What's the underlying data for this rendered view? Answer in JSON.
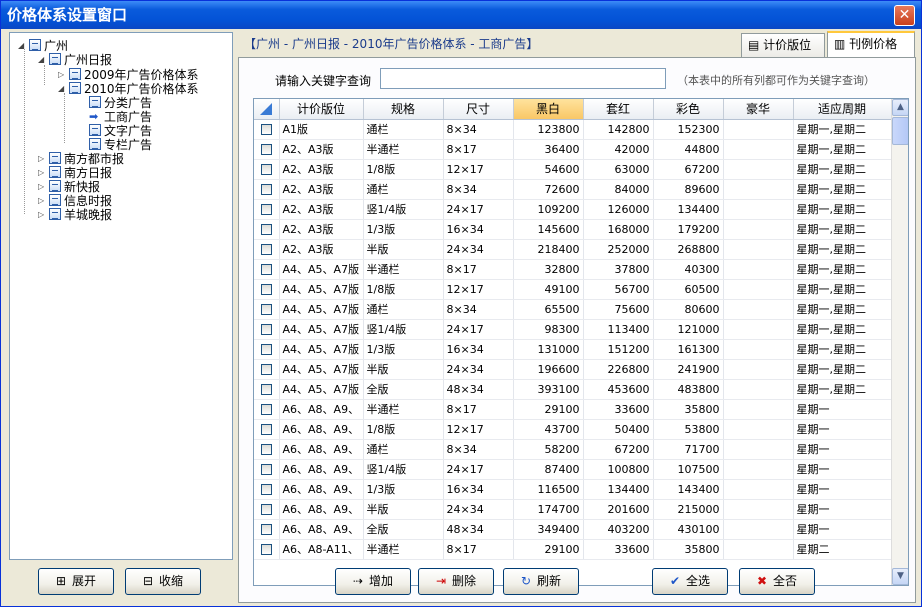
{
  "window": {
    "title": "价格体系设置窗口",
    "close_glyph": "✕"
  },
  "tree": {
    "root": "广州",
    "paper": "广州日报",
    "year2009": "2009年广告价格体系",
    "year2010": "2010年广告价格体系",
    "sub": [
      "分类广告",
      "工商广告",
      "文字广告",
      "专栏广告"
    ],
    "others": [
      "南方都市报",
      "南方日报",
      "新快报",
      "信息时报",
      "羊城晚报"
    ]
  },
  "left_buttons": {
    "expand": "展开",
    "collapse": "收缩"
  },
  "header": {
    "path": "【广州 - 广州日报 - 2010年广告价格体系 - 工商广告】"
  },
  "tabs": [
    {
      "label": "计价版位"
    },
    {
      "label": "刊例价格"
    }
  ],
  "search": {
    "label": "请输入关键字查询",
    "value": "",
    "placeholder": "",
    "hint": "（本表中的所有列都可作为关键字查询）"
  },
  "table": {
    "columns": [
      "",
      "计价版位",
      "规格",
      "尺寸",
      "黑白",
      "套红",
      "彩色",
      "豪华",
      "适应周期"
    ],
    "rows": [
      [
        "A1版",
        "通栏",
        "8×34",
        "123800",
        "142800",
        "152300",
        "",
        "星期一,星期二"
      ],
      [
        "A2、A3版",
        "半通栏",
        "8×17",
        "36400",
        "42000",
        "44800",
        "",
        "星期一,星期二"
      ],
      [
        "A2、A3版",
        "1/8版",
        "12×17",
        "54600",
        "63000",
        "67200",
        "",
        "星期一,星期二"
      ],
      [
        "A2、A3版",
        "通栏",
        "8×34",
        "72600",
        "84000",
        "89600",
        "",
        "星期一,星期二"
      ],
      [
        "A2、A3版",
        "竖1/4版",
        "24×17",
        "109200",
        "126000",
        "134400",
        "",
        "星期一,星期二"
      ],
      [
        "A2、A3版",
        "1/3版",
        "16×34",
        "145600",
        "168000",
        "179200",
        "",
        "星期一,星期二"
      ],
      [
        "A2、A3版",
        "半版",
        "24×34",
        "218400",
        "252000",
        "268800",
        "",
        "星期一,星期二"
      ],
      [
        "A4、A5、A7版",
        "半通栏",
        "8×17",
        "32800",
        "37800",
        "40300",
        "",
        "星期一,星期二"
      ],
      [
        "A4、A5、A7版",
        "1/8版",
        "12×17",
        "49100",
        "56700",
        "60500",
        "",
        "星期一,星期二"
      ],
      [
        "A4、A5、A7版",
        "通栏",
        "8×34",
        "65500",
        "75600",
        "80600",
        "",
        "星期一,星期二"
      ],
      [
        "A4、A5、A7版",
        "竖1/4版",
        "24×17",
        "98300",
        "113400",
        "121000",
        "",
        "星期一,星期二"
      ],
      [
        "A4、A5、A7版",
        "1/3版",
        "16×34",
        "131000",
        "151200",
        "161300",
        "",
        "星期一,星期二"
      ],
      [
        "A4、A5、A7版",
        "半版",
        "24×34",
        "196600",
        "226800",
        "241900",
        "",
        "星期一,星期二"
      ],
      [
        "A4、A5、A7版",
        "全版",
        "48×34",
        "393100",
        "453600",
        "483800",
        "",
        "星期一,星期二"
      ],
      [
        "A6、A8、A9、",
        "半通栏",
        "8×17",
        "29100",
        "33600",
        "35800",
        "",
        "星期一"
      ],
      [
        "A6、A8、A9、",
        "1/8版",
        "12×17",
        "43700",
        "50400",
        "53800",
        "",
        "星期一"
      ],
      [
        "A6、A8、A9、",
        "通栏",
        "8×34",
        "58200",
        "67200",
        "71700",
        "",
        "星期一"
      ],
      [
        "A6、A8、A9、",
        "竖1/4版",
        "24×17",
        "87400",
        "100800",
        "107500",
        "",
        "星期一"
      ],
      [
        "A6、A8、A9、",
        "1/3版",
        "16×34",
        "116500",
        "134400",
        "143400",
        "",
        "星期一"
      ],
      [
        "A6、A8、A9、",
        "半版",
        "24×34",
        "174700",
        "201600",
        "215000",
        "",
        "星期一"
      ],
      [
        "A6、A8、A9、",
        "全版",
        "48×34",
        "349400",
        "403200",
        "430100",
        "",
        "星期一"
      ],
      [
        "A6、A8-A11、",
        "半通栏",
        "8×17",
        "29100",
        "33600",
        "35800",
        "",
        "星期二"
      ]
    ]
  },
  "bottom_buttons": {
    "add": "增加",
    "delete": "删除",
    "refresh": "刷新",
    "select_all": "全选",
    "select_none": "全否"
  },
  "icons": {
    "tree_node": "page-icon",
    "current": "arrow-right-icon"
  }
}
